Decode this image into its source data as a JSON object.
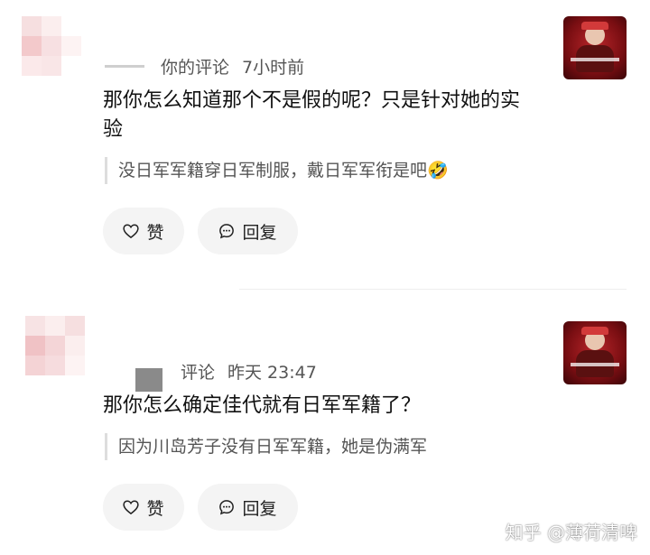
{
  "comments": [
    {
      "meta_label": "你的评论",
      "time": "7小时前",
      "text": "那你怎么知道那个不是假的呢？只是针对她的实验",
      "quote": "没日军军籍穿日军制服，戴日军军衔是吧",
      "quote_emoji": "🤣",
      "like_label": "赞",
      "reply_label": "回复"
    },
    {
      "meta_label": "评论",
      "time": "昨天 23:47",
      "text": "那你怎么确定佳代就有日军军籍了？",
      "quote": "因为川岛芳子没有日军军籍，她是伪满军",
      "like_label": "赞",
      "reply_label": "回复"
    }
  ],
  "watermark": "知乎 @薄荷清啤",
  "icons": {
    "like": "heart-outline-icon",
    "reply": "chat-bubble-icon"
  },
  "colors": {
    "button_bg": "#f4f4f4",
    "meta_text": "#555555",
    "thumb_red": "#b8262a"
  }
}
